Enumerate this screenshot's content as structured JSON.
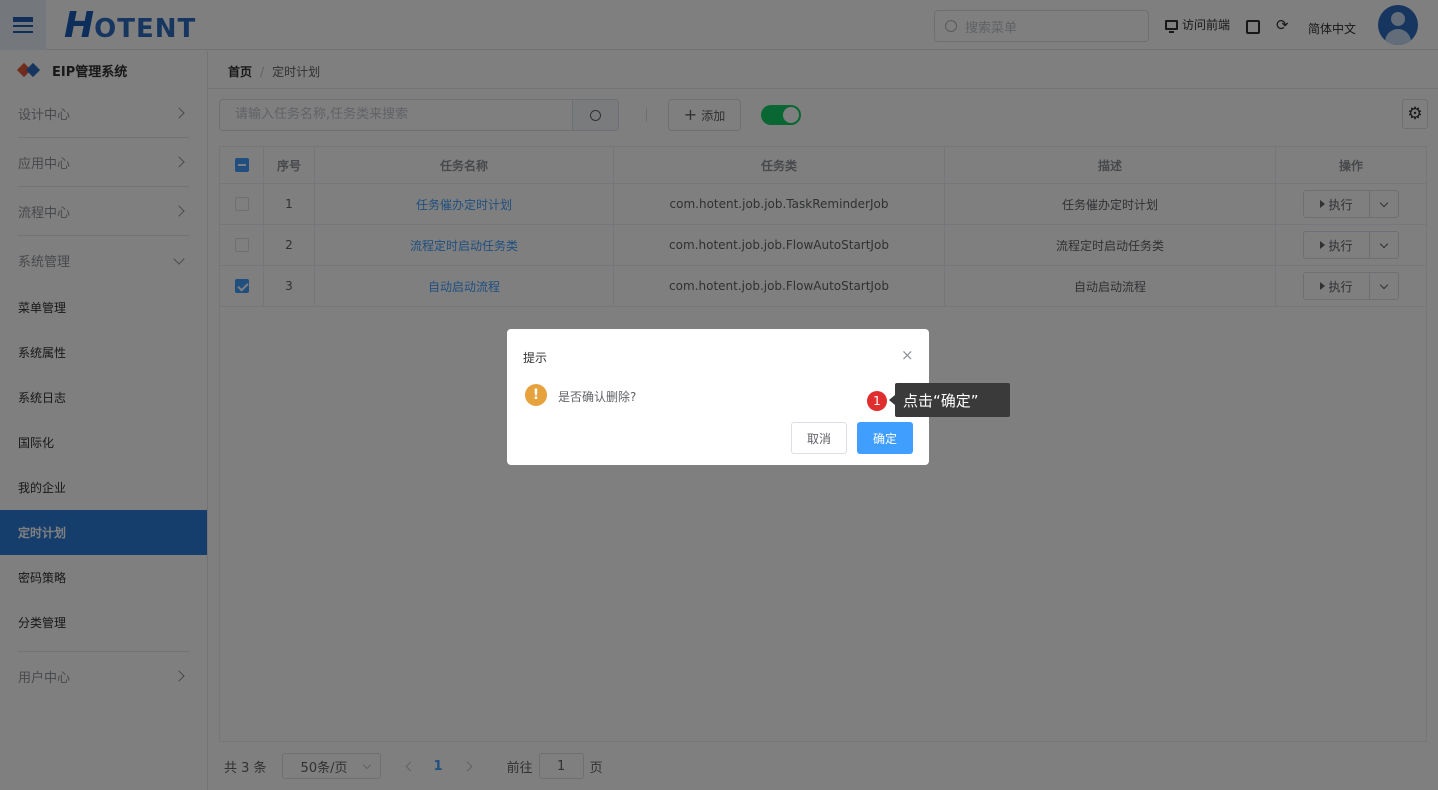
{
  "header": {
    "logo_big": "H",
    "logo_rest": "OTENT",
    "search_placeholder": "搜索菜单",
    "visit_frontend": "访问前端",
    "language": "简体中文"
  },
  "sidebar": {
    "system_title": "EIP管理系统",
    "groups": [
      {
        "label": "设计中心"
      },
      {
        "label": "应用中心"
      },
      {
        "label": "流程中心"
      },
      {
        "label": "系统管理"
      }
    ],
    "sub_items": [
      {
        "label": "菜单管理"
      },
      {
        "label": "系统属性"
      },
      {
        "label": "系统日志"
      },
      {
        "label": "国际化"
      },
      {
        "label": "我的企业"
      },
      {
        "label": "定时计划"
      },
      {
        "label": "密码策略"
      },
      {
        "label": "分类管理"
      }
    ],
    "bottom_group": {
      "label": "用户中心"
    },
    "active_item": "定时计划"
  },
  "breadcrumb": {
    "home": "首页",
    "sep": "/",
    "current": "定时计划"
  },
  "toolbar": {
    "search_placeholder": "请输入任务名称,任务类来搜索",
    "add_label": "添加",
    "toggle_on": true
  },
  "table": {
    "headers": [
      "序号",
      "任务名称",
      "任务类",
      "描述",
      "操作"
    ],
    "rows": [
      {
        "no": "1",
        "name": "任务催办定时计划",
        "cls": "com.hotent.job.job.TaskReminderJob",
        "desc": "任务催办定时计划",
        "action": "执行",
        "checked": false
      },
      {
        "no": "2",
        "name": "流程定时启动任务类",
        "cls": "com.hotent.job.job.FlowAutoStartJob",
        "desc": "流程定时启动任务类",
        "action": "执行",
        "checked": false
      },
      {
        "no": "3",
        "name": "自动启动流程",
        "cls": "com.hotent.job.job.FlowAutoStartJob",
        "desc": "自动启动流程",
        "action": "执行",
        "checked": true
      }
    ]
  },
  "pagination": {
    "total": "共 3 条",
    "page_size": "50条/页",
    "current_page": "1",
    "goto_label": "前往",
    "goto_value": "1",
    "page_suffix": "页"
  },
  "dialog": {
    "title": "提示",
    "close": "×",
    "message": "是否确认删除?",
    "cancel": "取消",
    "confirm": "确定"
  },
  "annotation": {
    "step": "1",
    "tip": "点击“确定”"
  },
  "colors": {
    "primary": "#409eff",
    "sidebar_active": "#2d7cd8",
    "switch_on": "#13ce66",
    "warning": "#e6a23c",
    "step_badge": "#e02d2d"
  }
}
